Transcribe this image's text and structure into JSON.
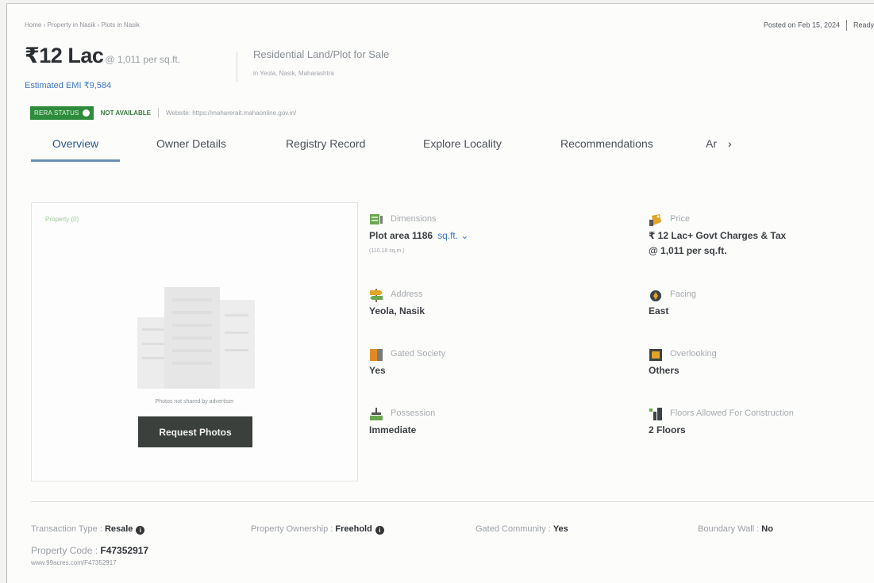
{
  "breadcrumb": "Home › Property in Nasik › Plots in Nasik",
  "posted": {
    "label": "Posted on Feb 15, 2024",
    "status": "Ready"
  },
  "price": {
    "amount": "₹12 Lac",
    "per_sqft": "@ 1,011 per sq.ft."
  },
  "emi": "Estimated EMI ₹9,584",
  "property": {
    "title": "Residential Land/Plot for Sale",
    "location": "in Yeola, Nasik, Maharashtra"
  },
  "rera": {
    "badge": "RERA STATUS",
    "status": "NOT AVAILABLE",
    "website": "Website: https://maharerait.mahaonline.gov.in/"
  },
  "tabs": [
    {
      "label": "Overview",
      "active": true
    },
    {
      "label": "Owner Details"
    },
    {
      "label": "Registry Record"
    },
    {
      "label": "Explore Locality"
    },
    {
      "label": "Recommendations"
    }
  ],
  "tab_more": "Ar",
  "photos": {
    "label": "Property (0)",
    "note": "Photos not shared by advertiser",
    "button": "Request Photos"
  },
  "attributes": {
    "dimensions": {
      "label": "Dimensions",
      "value": "Plot area 1186",
      "unit": "sq.ft.",
      "sub": "(110.18 sq.m.)",
      "icon": "dimensions-icon"
    },
    "price": {
      "label": "Price",
      "value": "₹ 12 Lac+ Govt Charges & Tax",
      "value2": "@ 1,011 per sq.ft.",
      "icon": "price-tag-icon"
    },
    "address": {
      "label": "Address",
      "value": "Yeola, Nasik",
      "icon": "signpost-icon"
    },
    "facing": {
      "label": "Facing",
      "value": "East",
      "icon": "compass-icon"
    },
    "gated": {
      "label": "Gated Society",
      "value": "Yes",
      "icon": "gate-icon"
    },
    "overlooking": {
      "label": "Overlooking",
      "value": "Others",
      "icon": "window-icon"
    },
    "possession": {
      "label": "Possession",
      "value": "Immediate",
      "icon": "calendar-icon"
    },
    "floors": {
      "label": "Floors Allowed For Construction",
      "value": "2 Floors",
      "icon": "floors-icon"
    }
  },
  "facts": {
    "transaction_label": "Transaction Type : ",
    "transaction_value": "Resale",
    "ownership_label": "Property Ownership : ",
    "ownership_value": "Freehold",
    "gated_label": "Gated Community : ",
    "gated_value": "Yes",
    "boundary_label": "Boundary Wall : ",
    "boundary_value": "No"
  },
  "code": {
    "label": "Property Code : ",
    "value": "F47352917",
    "url": "www.99acres.com/F47352917"
  },
  "colors": {
    "rera_green": "#2e8b3c",
    "link_blue": "#3b78c4",
    "button_dark": "#3c403d"
  }
}
